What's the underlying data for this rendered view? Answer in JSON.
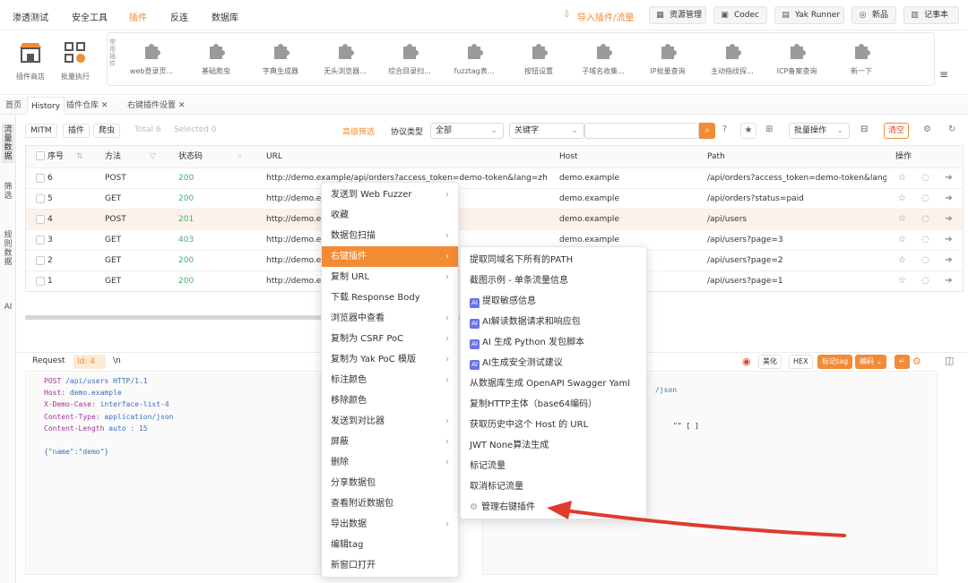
{
  "top_menu": {
    "items": [
      "渗透测试",
      "安全工具",
      "插件",
      "反连",
      "数据库"
    ],
    "active_index": 2,
    "import_label": "导入插件/流量",
    "right_buttons": [
      "资源管理",
      "Codec",
      "Yak Runner",
      "新品",
      "记事本"
    ]
  },
  "plugin_bar": {
    "big_tools": [
      "插件商店",
      "批量执行"
    ],
    "panel_label": "常用插件",
    "plugins": [
      "web登录页...",
      "基础爬虫",
      "字典生成器",
      "无头浏览器...",
      "综合目录扫...",
      "fuzztag表...",
      "按钮设置",
      "子域名收集...",
      "IP批量查询",
      "主动指纹探...",
      "ICP备案查询",
      "新一下"
    ]
  },
  "tabs": {
    "items": [
      "首页",
      "History",
      "插件仓库",
      "右键插件设置"
    ],
    "active_index": 1
  },
  "left_sidebar": [
    "流量数据",
    "筛选",
    "规则数据",
    "AI"
  ],
  "toolbar": {
    "mitm": "MITM",
    "plugin": "插件",
    "crawler": "爬虫",
    "total": "Total 6",
    "selected": "Selected 0",
    "advanced_filter": "高级筛选",
    "protocol_label": "协议类型",
    "protocol_value": "全部",
    "keyword_value": "关键字",
    "batch_ops": "批量操作",
    "clear": "清空"
  },
  "table": {
    "headers": [
      "序号",
      "方法",
      "状态码",
      "URL",
      "Host",
      "Path",
      "操作"
    ],
    "rows": [
      {
        "id": "6",
        "method": "POST",
        "status": "200",
        "url": "http://demo.example/api/orders?access_token=demo-token&lang=zh",
        "host": "demo.example",
        "path": "/api/orders?access_token=demo-token&lang=zh"
      },
      {
        "id": "5",
        "method": "GET",
        "status": "200",
        "url": "http://demo.e",
        "host": "demo.example",
        "path": "/api/orders?status=paid"
      },
      {
        "id": "4",
        "method": "POST",
        "status": "201",
        "url": "http://demo.e",
        "host": "demo.example",
        "path": "/api/users"
      },
      {
        "id": "3",
        "method": "GET",
        "status": "403",
        "url": "http://demo.e",
        "host": "demo.example",
        "path": "/api/users?page=3"
      },
      {
        "id": "2",
        "method": "GET",
        "status": "200",
        "url": "http://demo.e",
        "host": "demo.example",
        "path": "/api/users?page=2"
      },
      {
        "id": "1",
        "method": "GET",
        "status": "200",
        "url": "http://demo.e",
        "host": "demo.example",
        "path": "/api/users?page=1"
      }
    ]
  },
  "request_panel": {
    "title": "Request",
    "id_badge": "Id: 4",
    "ln": "\\n",
    "lines": [
      {
        "k": "POST",
        "v": " /api/users HTTP/1.1"
      },
      {
        "k": "Host",
        "v": ": demo.example"
      },
      {
        "k": "X-Demo-Case",
        "v": ": interface-list-4"
      },
      {
        "k": "Content-Type",
        "v": ": application/json"
      },
      {
        "k": "Content-Length",
        "v": " auto : 15"
      },
      {
        "k": "",
        "v": ""
      },
      {
        "k": "",
        "v": "{\"name\":\"demo\"}"
      }
    ]
  },
  "response_panel": {
    "tools": [
      "美化",
      "HEX",
      "标记tag",
      "编码"
    ],
    "lines": [
      "/json",
      "",
      "\"\" [ ]"
    ]
  },
  "context_menu": {
    "items": [
      "发送到 Web Fuzzer",
      "收藏",
      "数据包扫描",
      "右键插件",
      "复制 URL",
      "下载 Response Body",
      "浏览器中查看",
      "复制为 CSRF PoC",
      "复制为 Yak PoC 模版",
      "标注颜色",
      "移除颜色",
      "发送到对比器",
      "屏蔽",
      "删除",
      "分享数据包",
      "查看附近数据包",
      "导出数据",
      "编辑tag",
      "新窗口打开"
    ],
    "has_submenu": [
      true,
      false,
      true,
      true,
      true,
      false,
      true,
      true,
      true,
      true,
      false,
      true,
      true,
      true,
      false,
      false,
      true,
      false,
      false
    ],
    "active_index": 3
  },
  "submenu": {
    "items": [
      {
        "label": "提取同域名下所有的PATH",
        "ai": false
      },
      {
        "label": "截图示例 - 单条流量信息",
        "ai": false
      },
      {
        "label": "提取敏感信息",
        "ai": true
      },
      {
        "label": "AI解读数据请求和响应包",
        "ai": true
      },
      {
        "label": "AI 生成 Python 发包脚本",
        "ai": true
      },
      {
        "label": "AI生成安全测试建议",
        "ai": true
      },
      {
        "label": "从数据库生成 OpenAPI Swagger Yaml",
        "ai": false
      },
      {
        "label": "复制HTTP主体（base64编码）",
        "ai": false
      },
      {
        "label": "获取历史中这个 Host 的 URL",
        "ai": false
      },
      {
        "label": "JWT None算法生成",
        "ai": false
      },
      {
        "label": "标记流量",
        "ai": false
      },
      {
        "label": "取消标记流量",
        "ai": false
      },
      {
        "label": "管理右键插件",
        "ai": false
      }
    ]
  },
  "colors": {
    "accent": "#f28b34",
    "arrow": "#e03a2e",
    "ai_badge": "#6a73e8",
    "status_ok": "#3cb371"
  }
}
